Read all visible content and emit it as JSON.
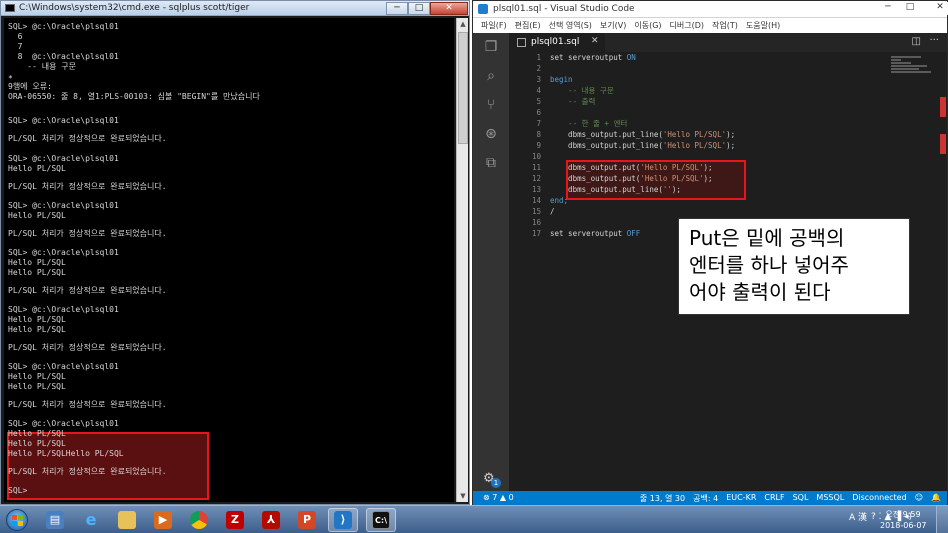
{
  "cmd": {
    "title": "C:\\Windows\\system32\\cmd.exe - sqlplus  scott/tiger",
    "minimize": "─",
    "maximize": "□",
    "close": "✕",
    "lines": [
      "SQL> @c:\\Oracle\\plsql01",
      "  6",
      "  7",
      "  8  @c:\\Oracle\\plsql01",
      "    -- 내용 구문",
      "*",
      "9행에 오류:",
      "ORA-06550: 줄 8, 열1:PLS-00103: 심볼 \"BEGIN\"를 만났습니다",
      "SQL> @c:\\Oracle\\plsql01",
      "PL/SQL 처리가 정상적으로 완료되었습니다.",
      "SQL> @c:\\Oracle\\plsql01",
      "Hello PL/SQL",
      "PL/SQL 처리가 정상적으로 완료되었습니다.",
      "SQL> @c:\\Oracle\\plsql01",
      "Hello PL/SQL",
      "PL/SQL 처리가 정상적으로 완료되었습니다.",
      "SQL> @c:\\Oracle\\plsql01",
      "Hello PL/SQL",
      "Hello PL/SQL",
      "PL/SQL 처리가 정상적으로 완료되었습니다.",
      "SQL> @c:\\Oracle\\plsql01",
      "Hello PL/SQL",
      "Hello PL/SQL",
      "PL/SQL 처리가 정상적으로 완료되었습니다.",
      "SQL> @c:\\Oracle\\plsql01",
      "Hello PL/SQL",
      "Hello PL/SQL",
      "PL/SQL 처리가 정상적으로 완료되었습니다.",
      "SQL> @c:\\Oracle\\plsql01",
      "Hello PL/SQL",
      "Hello PL/SQL",
      "Hello PL/SQLHello PL/SQL",
      "PL/SQL 처리가 정상적으로 완료되었습니다.",
      "SQL>"
    ]
  },
  "vscode": {
    "title": "plsql01.sql - Visual Studio Code",
    "menu": [
      "파일(F)",
      "편집(E)",
      "선택 영역(S)",
      "보기(V)",
      "이동(G)",
      "디버그(D)",
      "작업(T)",
      "도움말(H)"
    ],
    "tab_label": "plsql01.sql",
    "tab_close": "✕",
    "split_icon": "◫",
    "more_icon": "···",
    "line_numbers": [
      "1",
      "2",
      "3",
      "4",
      "5",
      "6",
      "7",
      "8",
      "9",
      "10",
      "11",
      "12",
      "13",
      "14",
      "15",
      "16",
      "17"
    ],
    "code": {
      "l1a": "set serveroutput ",
      "l1b": "ON",
      "l3": "begin",
      "l4": "    -- 내용 구문",
      "l5": "    -- 출력",
      "l7": "    -- 한 줄 + 엔터",
      "l8a": "    dbms_output.put_line(",
      "l8b": "'Hello PL/SQL'",
      "l8c": ");",
      "l9a": "    dbms_output.put_line(",
      "l9b": "'Hello PL/SQL'",
      "l9c": ");",
      "l11a": "    dbms_output.put(",
      "l11b": "'Hello PL/SQL'",
      "l11c": ");",
      "l12a": "    dbms_output.put(",
      "l12b": "'Hello PL/SQL'",
      "l12c": ");",
      "l13a": "    dbms_output.put_line(",
      "l13b": "''",
      "l13c": ");",
      "l14": "end;",
      "l15": "/",
      "l17a": "set serveroutput ",
      "l17b": "OFF"
    },
    "status": {
      "problems": "⊗ 7 ▲ 0",
      "position": "줄 13, 열 30",
      "spaces": "공백: 4",
      "encoding": "EUC-KR",
      "eol": "CRLF",
      "language": "SQL",
      "connection": "MSSQL",
      "state": "Disconnected",
      "feedback": "☺",
      "bell": "🔔"
    },
    "gear_badge": "1"
  },
  "annotation": {
    "line1": "Put은 밑에 공백의",
    "line2": "엔터를 하나 넣어주",
    "line3": "어야 출력이 된다"
  },
  "taskbar": {
    "apps": [
      "windows-explorer",
      "internet-explorer",
      "file-explorer",
      "media-player",
      "chrome",
      "filezilla",
      "acrobat",
      "powerpoint",
      "vscode",
      "cmd"
    ],
    "tray_lang": "A 漢",
    "tray_icons": "? ⁚ ▲ ▐ ◂)",
    "time": "오전 9:59",
    "date": "2018-06-07"
  },
  "colors": {
    "highlight_border": "#e8151b",
    "vscode_status": "#007acc",
    "keyword": "#569cd6",
    "comment": "#608b4e",
    "string": "#ce9178"
  }
}
